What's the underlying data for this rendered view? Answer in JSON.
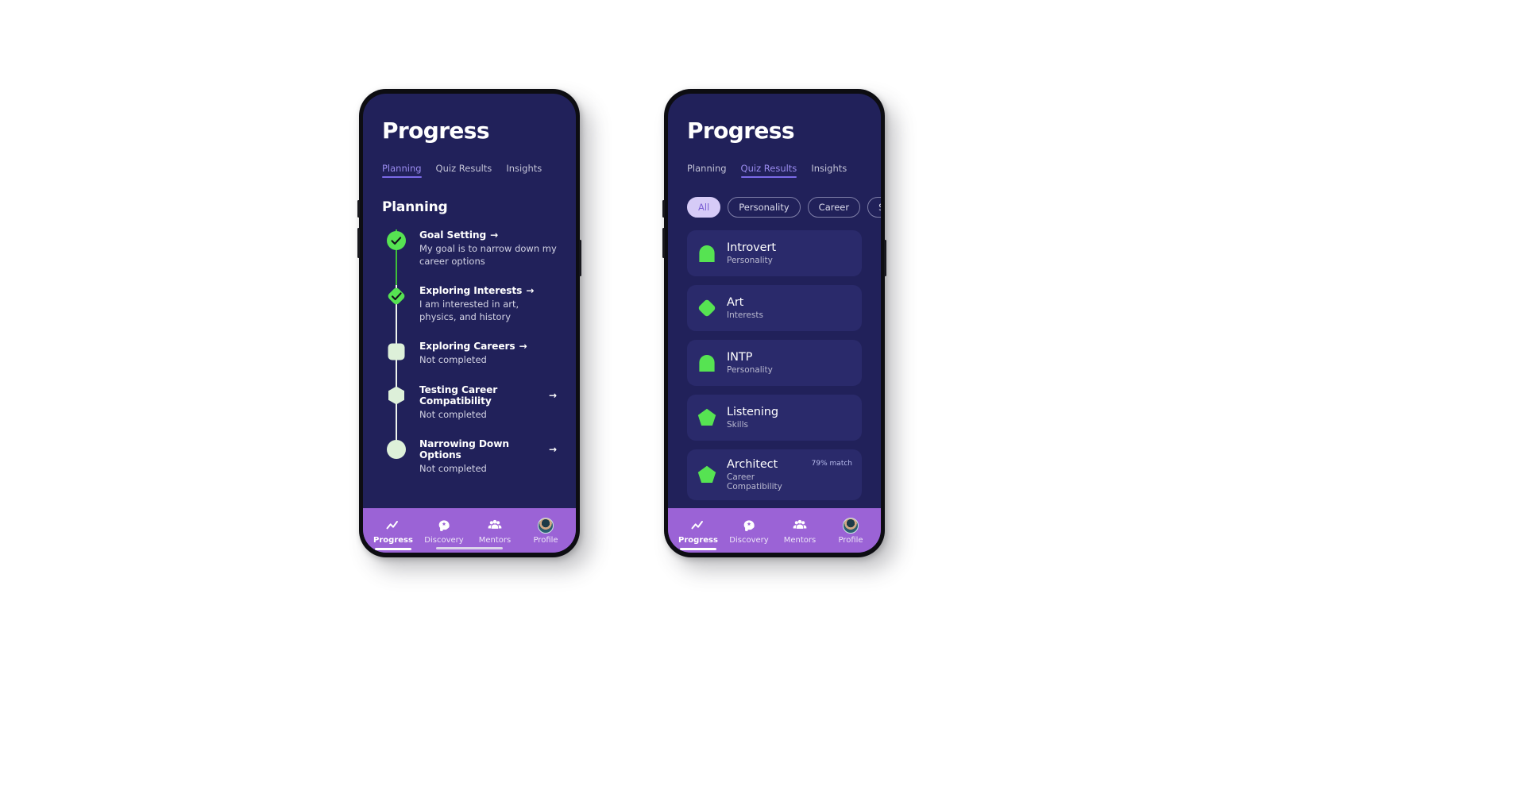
{
  "colors": {
    "screen_bg": "#21215a",
    "card_bg": "#2a2a6b",
    "accent_purple": "#7b6ae8",
    "nav_bg": "#9b63d6",
    "chip_active_bg": "#d6cbf7",
    "chip_active_text": "#7b5fd4",
    "marker_done": "#56e352",
    "marker_todo": "#ddf0d9",
    "icon_green": "#56e352",
    "line_done": "#3fbf3a",
    "line_todo": "#eef3ee"
  },
  "phones": [
    {
      "id": "left",
      "title": "Progress",
      "tabs": [
        {
          "label": "Planning",
          "active": true
        },
        {
          "label": "Quiz Results",
          "active": false
        },
        {
          "label": "Insights",
          "active": false
        }
      ],
      "section_title": "Planning",
      "timeline": [
        {
          "title": "Goal Setting",
          "arrow": "→",
          "desc": "My goal is to narrow down my career options",
          "marker": "circle-check-icon",
          "state": "done"
        },
        {
          "title": "Exploring Interests",
          "arrow": "→",
          "desc": "I am interested in art, physics, and history",
          "marker": "diamond-check-icon",
          "state": "done"
        },
        {
          "title": "Exploring Careers",
          "arrow": "→",
          "desc": "Not completed",
          "marker": "rounded-square-icon",
          "state": "todo"
        },
        {
          "title": "Testing Career Compatibility",
          "arrow": "→",
          "desc": "Not completed",
          "marker": "hexagon-icon",
          "state": "todo"
        },
        {
          "title": "Narrowing Down Options",
          "arrow": "→",
          "desc": "Not completed",
          "marker": "circle-icon",
          "state": "todo"
        }
      ]
    },
    {
      "id": "right",
      "title": "Progress",
      "tabs": [
        {
          "label": "Planning",
          "active": false
        },
        {
          "label": "Quiz Results",
          "active": true
        },
        {
          "label": "Insights",
          "active": false
        }
      ],
      "chips": [
        {
          "label": "All",
          "active": true
        },
        {
          "label": "Personality",
          "active": false
        },
        {
          "label": "Career",
          "active": false
        },
        {
          "label": "S",
          "active": false
        }
      ],
      "cards": [
        {
          "title": "Introvert",
          "sub": "Personality",
          "icon": "dome-icon",
          "match": ""
        },
        {
          "title": "Art",
          "sub": "Interests",
          "icon": "diamond-icon",
          "match": ""
        },
        {
          "title": "INTP",
          "sub": "Personality",
          "icon": "dome-icon",
          "match": ""
        },
        {
          "title": "Listening",
          "sub": "Skills",
          "icon": "pentagon-icon",
          "match": ""
        },
        {
          "title": "Architect",
          "sub": "Career Compatibility",
          "icon": "pentagon-icon",
          "match": "79% match"
        }
      ]
    }
  ],
  "bottom_nav": {
    "items": [
      {
        "label": "Progress",
        "icon": "trend-line-icon",
        "active": true
      },
      {
        "label": "Discovery",
        "icon": "head-sparkle-icon",
        "active": false
      },
      {
        "label": "Mentors",
        "icon": "people-group-icon",
        "active": false
      },
      {
        "label": "Profile",
        "icon": "avatar-icon",
        "active": false
      }
    ]
  }
}
